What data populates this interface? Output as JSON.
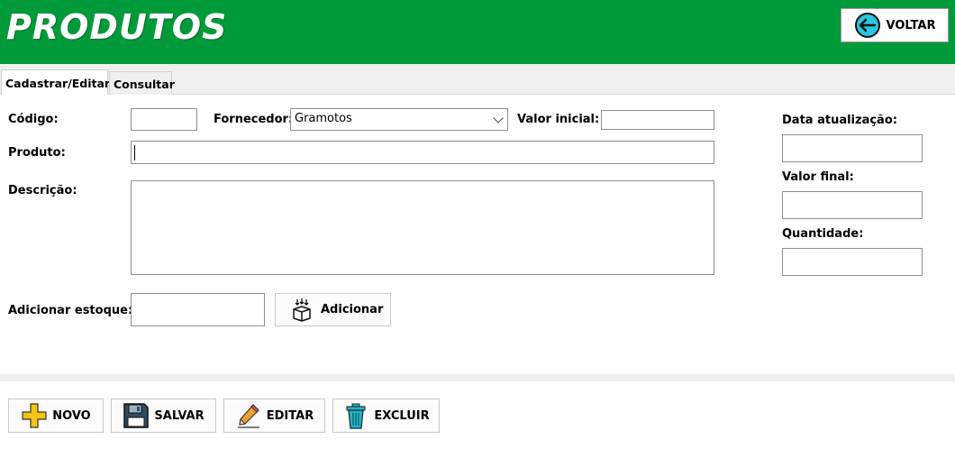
{
  "header": {
    "title": "PRODUTOS",
    "back_label": "VOLTAR",
    "bg_color": "#009a3a"
  },
  "tabs": [
    {
      "label": "Cadastrar/Editar",
      "active": true
    },
    {
      "label": "Consultar",
      "active": false
    }
  ],
  "form": {
    "codigo_label": "Código:",
    "fornecedor_label": "Fornecedor:",
    "fornecedor_value": "Gramotos",
    "valor_inicial_label": "Valor inicial:",
    "produto_label": "Produto:",
    "descricao_label": "Descrição:",
    "adicionar_estoque_label": "Adicionar estoque:",
    "adicionar_button": "Adicionar",
    "data_atualizacao_label": "Data atualização:",
    "valor_final_label": "Valor final:",
    "quantidade_label": "Quantidade:"
  },
  "footer": {
    "novo": "NOVO",
    "salvar": "SALVAR",
    "editar": "EDITAR",
    "excluir": "EXCLUIR"
  }
}
